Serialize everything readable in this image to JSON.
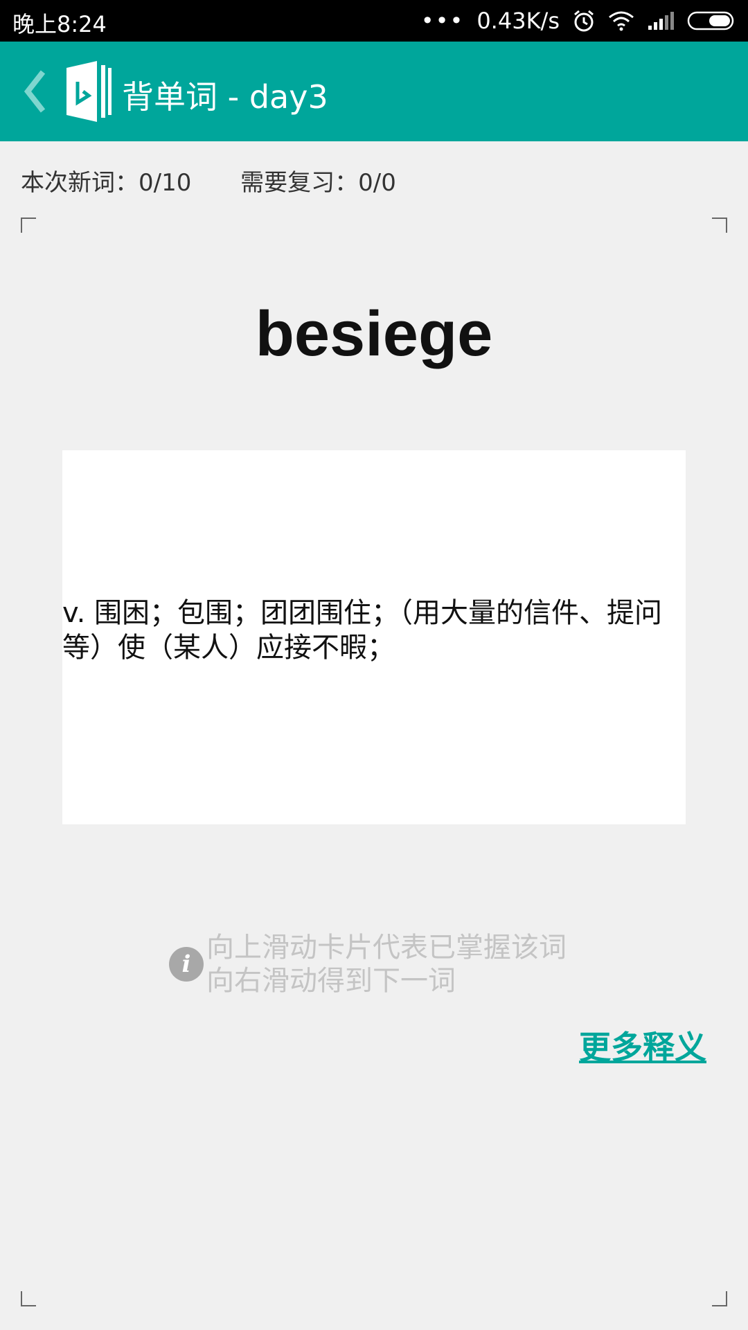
{
  "status_bar": {
    "time": "晚上8:24",
    "dots": "•••",
    "speed": "0.43K/s",
    "icons": [
      "alarm-icon",
      "wifi-icon",
      "signal-icon",
      "battery-icon"
    ]
  },
  "app_bar": {
    "title": "背单词 - day3",
    "color": "#00a69b",
    "icons": [
      "back-icon",
      "app-logo-icon"
    ]
  },
  "counters": {
    "new_words": "本次新词：0/10",
    "review": "需要复习：0/0"
  },
  "card": {
    "word": "besiege",
    "definition": "v. 围困；包围；团团围住；（用大量的信件、提问等）使（某人）应接不暇；"
  },
  "hint": {
    "icon": "info-icon",
    "line1": "向上滑动卡片代表已掌握该词",
    "line2": "向右滑动得到下一词"
  },
  "more_link": "更多释义"
}
